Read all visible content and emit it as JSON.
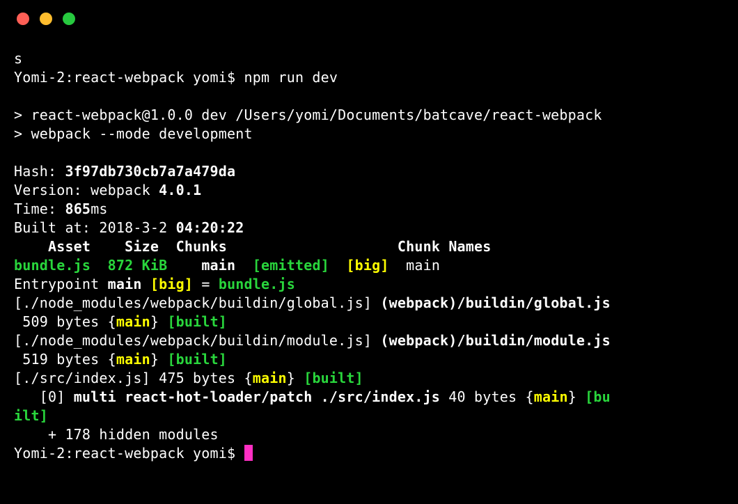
{
  "colors": {
    "bg": "#000000",
    "fg": "#ffffff",
    "green": "#29d63c",
    "yellow": "#ffff00",
    "cursor": "#ff2fc3",
    "trafficRed": "#ff5f56",
    "trafficYellow": "#ffbd2e",
    "trafficGreen": "#27c93f"
  },
  "line_s": "s",
  "prompt1": "Yomi-2:react-webpack yomi$ npm run dev",
  "blank": "",
  "script_line1": "> react-webpack@1.0.0 dev /Users/yomi/Documents/batcave/react-webpack",
  "script_line2": "> webpack --mode development",
  "hash_label": "Hash: ",
  "hash_value": "3f97db730cb7a7a479da",
  "version_label": "Version: webpack ",
  "version_value": "4.0.1",
  "time_label": "Time: ",
  "time_value": "865",
  "time_suffix": "ms",
  "built_label": "Built at: 2018-3-2 ",
  "built_value": "04:20:22",
  "header_asset": "    Asset",
  "header_size": "    Size",
  "header_chunks": "  Chunks",
  "header_chunknames": "                    Chunk Names",
  "row_asset": "bundle.js",
  "row_size": "  872 KiB",
  "row_chunks_pre": "    ",
  "row_chunks": "main",
  "row_emitted": "  [emitted]",
  "row_big": "  [big]",
  "row_chunknames": "  main",
  "entry_prefix": "Entrypoint ",
  "entry_main": "main ",
  "entry_big": "[big]",
  "entry_eq": " = ",
  "entry_bundle": "bundle.js",
  "mod1_path": "[./node_modules/webpack/buildin/global.js] ",
  "mod1_desc": "(webpack)/buildin/global.js",
  "mod1_size": " 509 bytes {",
  "mod1_chunk": "main",
  "mod1_close": "} ",
  "mod1_built": "[built]",
  "mod2_path": "[./node_modules/webpack/buildin/module.js] ",
  "mod2_desc": "(webpack)/buildin/module.js",
  "mod2_size": " 519 bytes {",
  "mod2_chunk": "main",
  "mod2_close": "} ",
  "mod2_built": "[built]",
  "mod3_path": "[./src/index.js] 475 bytes {",
  "mod3_chunk": "main",
  "mod3_close": "} ",
  "mod3_built": "[built]",
  "mod4_prefix": "   [0] ",
  "mod4_desc": "multi react-hot-loader/patch ./src/index.js",
  "mod4_size": " 40 bytes {",
  "mod4_chunk": "main",
  "mod4_close": "} ",
  "mod4_built1": "[bu",
  "mod4_built2": "ilt]",
  "hidden": "    + 178 hidden modules",
  "prompt2": "Yomi-2:react-webpack yomi$ "
}
